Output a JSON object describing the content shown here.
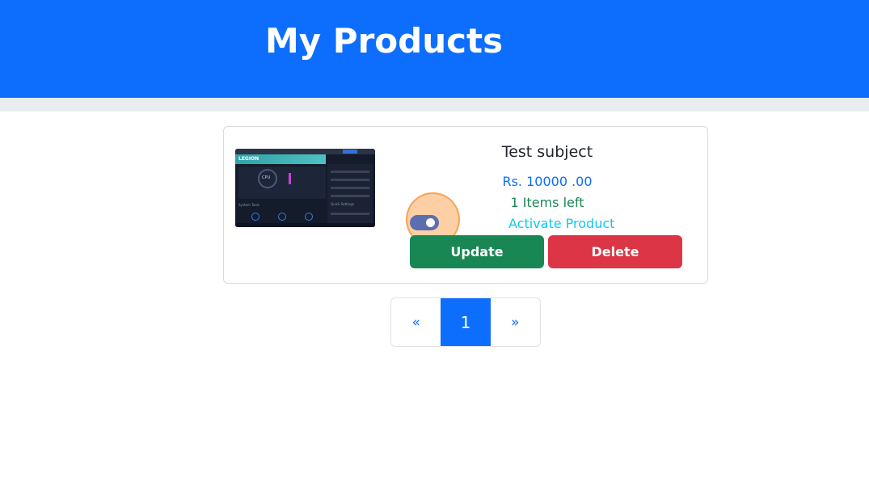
{
  "header": {
    "title": "My Products"
  },
  "product": {
    "title": "Test subject",
    "price": "Rs. 10000 .00",
    "stock": "1 Items left",
    "activate_label": "Activate Product",
    "active": true,
    "update_label": "Update",
    "delete_label": "Delete",
    "thumbnail": {
      "logo_text": "LEGION",
      "gauge_text": "CPU",
      "system_tools_label": "System Tools",
      "quick_settings_label": "Quick Settings"
    }
  },
  "pagination": {
    "prev_label": "«",
    "current_page": "1",
    "next_label": "»"
  },
  "colors": {
    "brand": "#0d6efd",
    "success": "#198754",
    "danger": "#dc3545",
    "info": "#0dcaf0",
    "highlight": "#f5963c"
  }
}
